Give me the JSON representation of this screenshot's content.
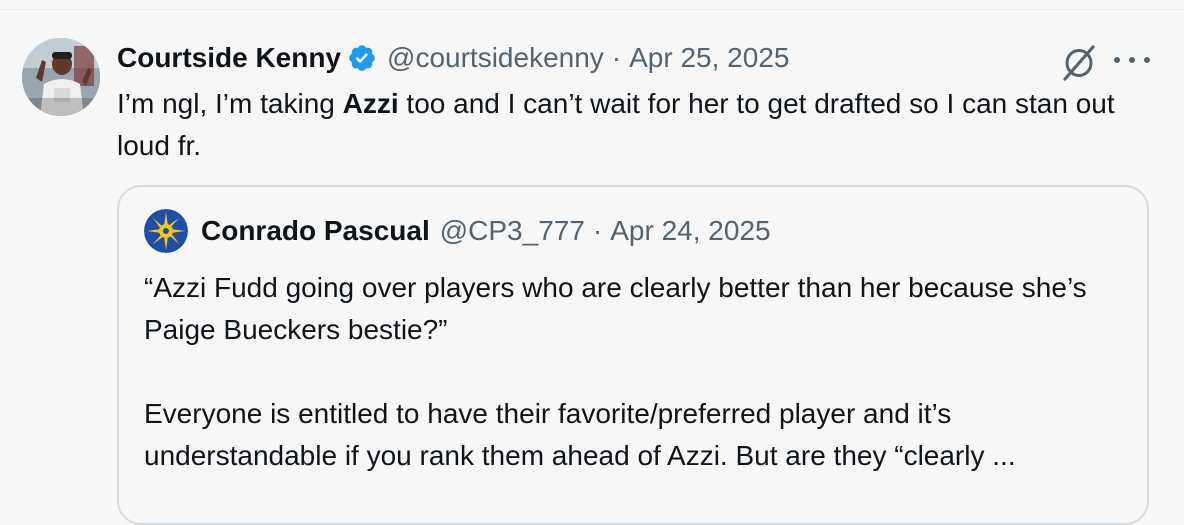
{
  "post": {
    "author_name": "Courtside Kenny",
    "handle": "@courtsidekenny",
    "separator": "·",
    "date": "Apr 25, 2025",
    "text_before": "I’m ngl, I’m taking ",
    "text_bold": "Azzi",
    "text_after": " too and I can’t wait for her to get drafted so I can stan out loud fr.",
    "icons": {
      "verified": "verified-badge-icon",
      "grok": "grok-icon",
      "more": "more-options-icon"
    }
  },
  "quoted_post": {
    "author_name": "Conrado Pascual",
    "handle": "@CP3_777",
    "separator": "·",
    "date": "Apr 24, 2025",
    "paragraph_1": "“Azzi Fudd going over players who are clearly better than her because she’s Paige Bueckers bestie?”",
    "paragraph_2": "Everyone is entitled to have their favorite/preferred player and it’s understandable if you rank them ahead of Azzi. But are they “clearly ..."
  },
  "colors": {
    "background": "#f7f7f8",
    "text_primary": "#0f1419",
    "text_secondary": "#536471",
    "verified_blue": "#1d9bf0",
    "border": "#d6dde2"
  }
}
